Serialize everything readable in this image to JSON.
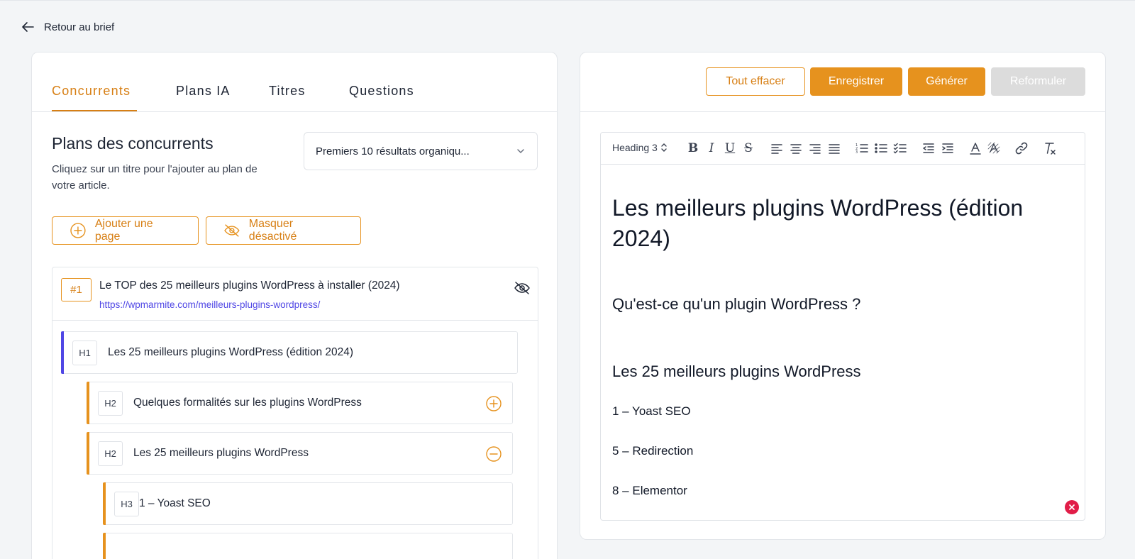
{
  "nav": {
    "back_label": "Retour au brief"
  },
  "tabs": [
    {
      "label": "Concurrents",
      "active": true
    },
    {
      "label": "Plans IA",
      "active": false
    },
    {
      "label": "Titres",
      "active": false
    },
    {
      "label": "Questions",
      "active": false
    }
  ],
  "left": {
    "title": "Plans des concurrents",
    "description": "Cliquez sur un titre pour l'ajouter au plan de votre article.",
    "select_value": "Premiers 10 résultats organiqu...",
    "add_page_label": "Ajouter une page",
    "hide_disabled_label": "Masquer désactivé",
    "competitor": {
      "rank": "#1",
      "title": "Le TOP des 25 meilleurs plugins WordPress à installer (2024)",
      "url": "https://wpmarmite.com/meilleurs-plugins-wordpress/"
    },
    "headings": [
      {
        "level": "H1",
        "text": "Les 25 meilleurs plugins WordPress (édition 2024)",
        "action": "none"
      },
      {
        "level": "H2",
        "text": "Quelques formalités sur les plugins WordPress",
        "action": "plus"
      },
      {
        "level": "H2",
        "text": "Les 25 meilleurs plugins WordPress",
        "action": "minus"
      },
      {
        "level": "H3",
        "text": "1 – Yoast SEO",
        "action": "none"
      }
    ]
  },
  "right": {
    "buttons": {
      "clear": "Tout effacer",
      "save": "Enregistrer",
      "generate": "Générer",
      "rephrase": "Reformuler"
    },
    "toolbar": {
      "heading_select": "Heading 3"
    },
    "document": {
      "h1": "Les meilleurs plugins WordPress (édition 2024)",
      "h2_1": "Qu'est-ce qu'un plugin WordPress ?",
      "h2_2": "Les 25 meilleurs plugins WordPress",
      "p1": "1 – Yoast SEO",
      "p2": "5 – Redirection",
      "p3": "8 – Elementor"
    }
  },
  "colors": {
    "accent": "#e6921e",
    "accent_text": "#d77f14",
    "link": "#4f46e5",
    "h1_bar": "#4f46e5",
    "error": "#e11d48"
  }
}
